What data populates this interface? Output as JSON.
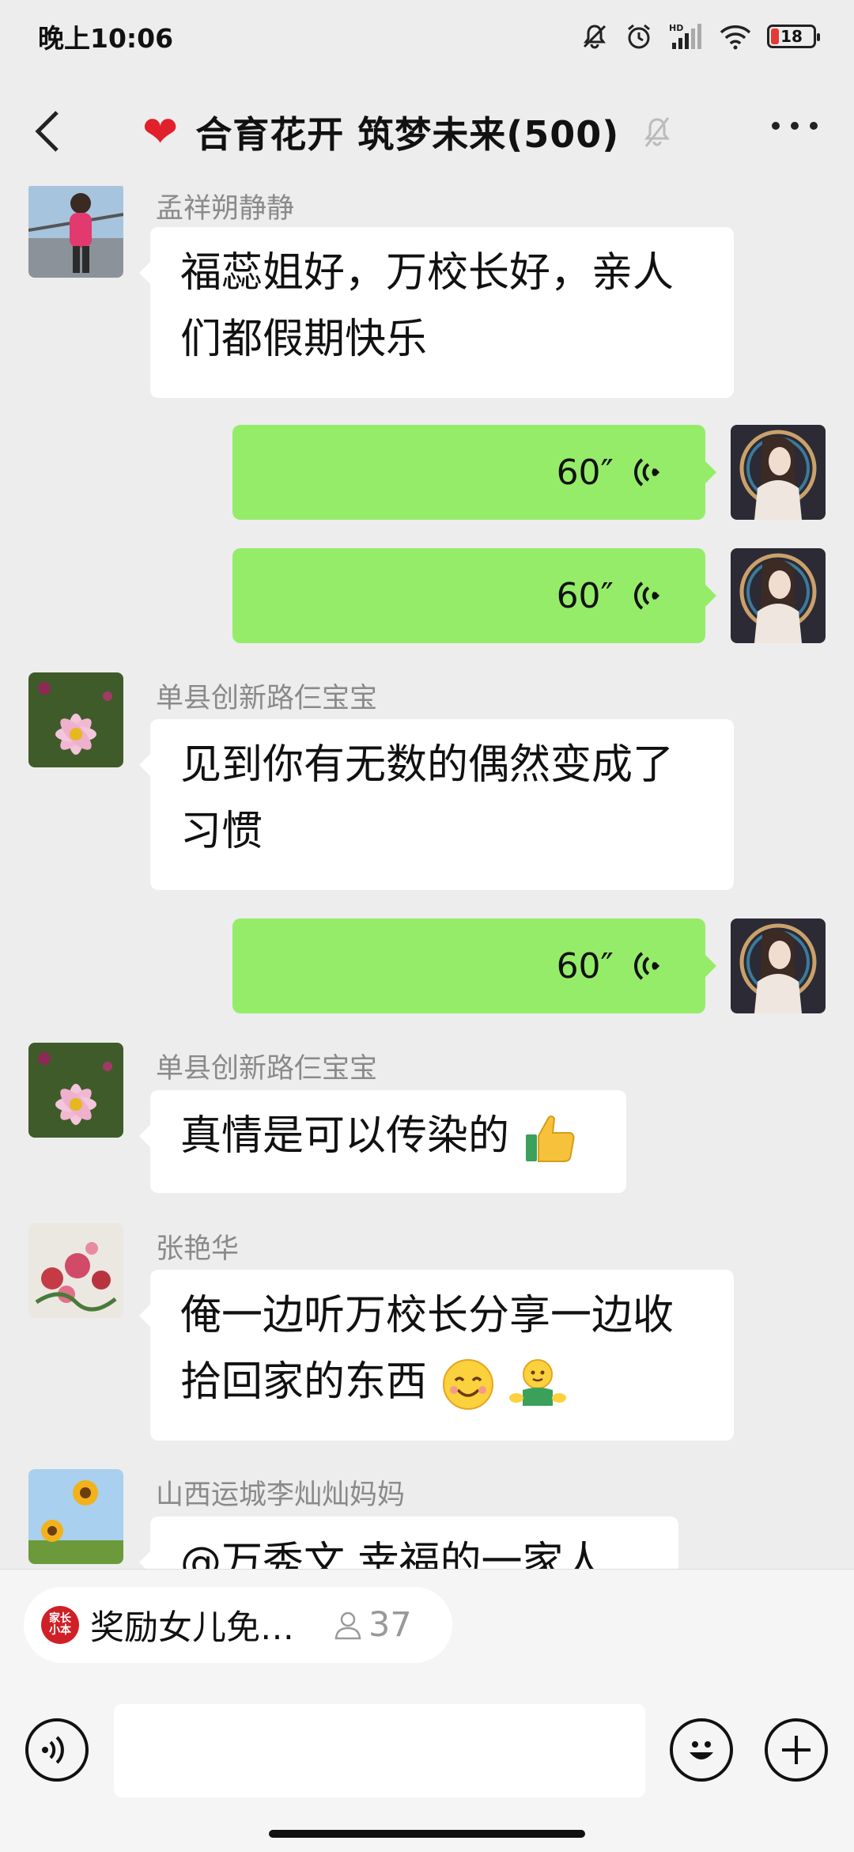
{
  "status_bar": {
    "time": "晚上10:06",
    "battery": "18"
  },
  "header": {
    "title": "合育花开 筑梦未来(500)"
  },
  "messages": [
    {
      "sender": "孟祥朔静静",
      "text_line1": "福蕊姐好，万校长好，亲人",
      "text_line2": "们都假期快乐"
    },
    {
      "duration": "60″"
    },
    {
      "duration": "60″"
    },
    {
      "sender": "单县创新路仨宝宝",
      "text_line1": "见到你有无数的偶然变成了",
      "text_line2": "习惯"
    },
    {
      "duration": "60″"
    },
    {
      "sender": "单县创新路仨宝宝",
      "text_line1": "真情是可以传染的"
    },
    {
      "sender": "张艳华",
      "text_line1": "俺一边听万校长分享一边收",
      "text_line2": "拾回家的东西"
    },
    {
      "sender": "山西运城李灿灿妈妈",
      "text_line1": "@万秀文 幸福的一家人"
    }
  ],
  "live_bar": {
    "logo_text": "家长小本",
    "title": "奖励女儿免…",
    "viewers": "37"
  },
  "colors": {
    "voice_bubble": "#95ec69",
    "background": "#ededed"
  }
}
